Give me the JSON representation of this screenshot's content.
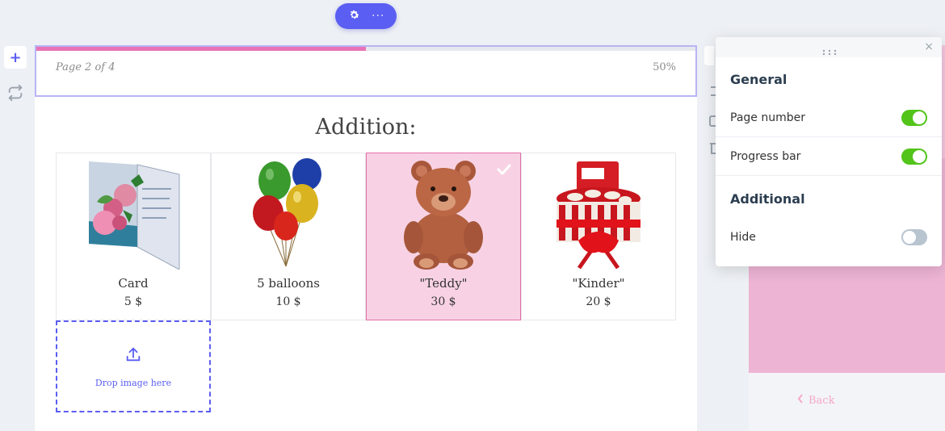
{
  "toolbar": {
    "settings_icon": "gear-icon",
    "more_icon": "ellipsis-icon",
    "more_glyph": "···"
  },
  "left_tools": {
    "add_glyph": "+"
  },
  "progress": {
    "page_label": "Page 2 of 4",
    "percent_label": "50%",
    "fraction": 0.5,
    "fill_color": "#e874b7"
  },
  "question": {
    "title": "Addition:"
  },
  "options": [
    {
      "name": "Card",
      "price": "5 $",
      "selected": false
    },
    {
      "name": "5 balloons",
      "price": "10 $",
      "selected": false
    },
    {
      "name": "\"Teddy\"",
      "price": "30 $",
      "selected": true
    },
    {
      "name": "\"Kinder\"",
      "price": "20 $",
      "selected": false
    }
  ],
  "dropzone": {
    "label": "Drop image here"
  },
  "right_page": {
    "back_label": "Back"
  },
  "settings_panel": {
    "close_glyph": "×",
    "general_title": "General",
    "page_number_label": "Page number",
    "page_number_on": true,
    "progress_bar_label": "Progress bar",
    "progress_bar_on": true,
    "additional_title": "Additional",
    "hide_label": "Hide",
    "hide_on": false
  },
  "colors": {
    "accent": "#5b5ef2",
    "selected_bg": "#f8d2e4",
    "selected_border": "#e46fa8",
    "toggle_on": "#52c41a"
  }
}
